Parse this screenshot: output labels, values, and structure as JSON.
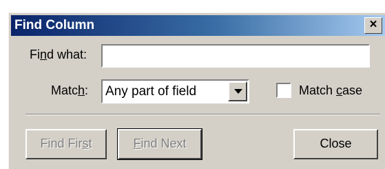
{
  "window": {
    "title": "Find Column",
    "close_glyph": "×",
    "close_icon": "close-icon"
  },
  "find": {
    "label_pre": "Fi",
    "label_mnemonic": "n",
    "label_post": "d what:",
    "value": ""
  },
  "match": {
    "label_pre": "Matc",
    "label_mnemonic": "h",
    "label_post": ":",
    "selected": "Any part of field",
    "arrow_icon": "dropdown-arrow-icon"
  },
  "match_case": {
    "label_pre": "Match ",
    "label_mnemonic": "c",
    "label_post": "ase",
    "checked": false
  },
  "buttons": {
    "find_first": {
      "pre": "Find Fir",
      "mnemonic": "s",
      "post": "t",
      "enabled": false
    },
    "find_next": {
      "pre": "",
      "mnemonic": "F",
      "post": "ind Next",
      "enabled": false
    },
    "close": {
      "label": "Close",
      "enabled": true
    }
  }
}
